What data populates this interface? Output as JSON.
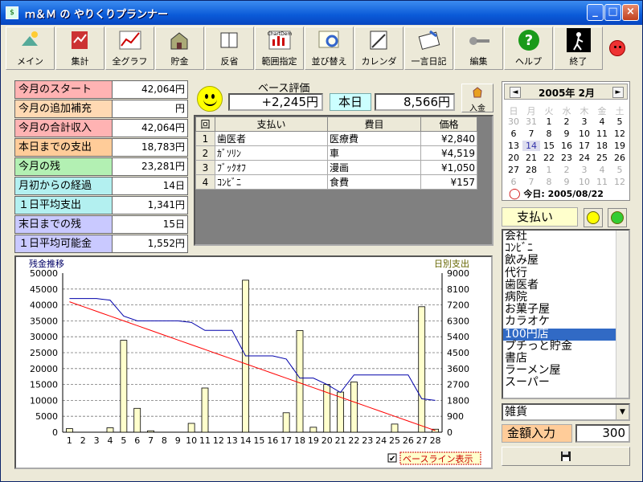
{
  "window": {
    "title": "ｍ＆Ｍ の やりくりプランナー",
    "icon": "app-icon"
  },
  "toolbar": [
    {
      "label": "メイン",
      "icon": "main-icon"
    },
    {
      "label": "集計",
      "icon": "summary-icon"
    },
    {
      "label": "全グラフ",
      "icon": "graph-icon"
    },
    {
      "label": "貯金",
      "icon": "savings-icon"
    },
    {
      "label": "反省",
      "icon": "review-icon"
    },
    {
      "label": "範囲指定",
      "icon": "range-icon"
    },
    {
      "label": "並び替え",
      "icon": "sort-icon"
    },
    {
      "label": "カレンダ",
      "icon": "calendar-icon"
    },
    {
      "label": "一言日記",
      "icon": "diary-icon"
    },
    {
      "label": "編集",
      "icon": "edit-icon"
    },
    {
      "label": "ヘルプ",
      "icon": "help-icon"
    },
    {
      "label": "終了",
      "icon": "exit-icon"
    }
  ],
  "toolbar_extra": {
    "range_icon_text": "ChartDem"
  },
  "summary": [
    {
      "label": "今月のスタート",
      "value": "42,064円",
      "color": "#ffb3b3"
    },
    {
      "label": "今月の追加補充",
      "value": "円",
      "color": "#ffd9b3"
    },
    {
      "label": "今月の合計収入",
      "value": "42,064円",
      "color": "#ffb3b3"
    },
    {
      "label": "本日までの支出",
      "value": "18,783円",
      "color": "#ffcc99"
    },
    {
      "label": "今月の残",
      "value": "23,281円",
      "color": "#b3f0b3"
    },
    {
      "label": "月初からの経過",
      "value": "14日",
      "color": "#b3f0f0"
    },
    {
      "label": "１日平均支出",
      "value": "1,341円",
      "color": "#b3f0f0"
    },
    {
      "label": "末日までの残",
      "value": "15日",
      "color": "#c9c9ff"
    },
    {
      "label": "１日平均可能金",
      "value": "1,552円",
      "color": "#c9c9ff"
    }
  ],
  "evaluation": {
    "label": "ベース評価",
    "value": "+2,245円",
    "today_label": "本日",
    "today_value": "8,566円",
    "deposit_label": "入金"
  },
  "payments": {
    "headers": [
      "回",
      "支払い",
      "費目",
      "価格"
    ],
    "rows": [
      [
        "1",
        "歯医者",
        "医療費",
        "¥2,840"
      ],
      [
        "2",
        "ｶﾞｿﾘﾝ",
        "車",
        "¥4,519"
      ],
      [
        "3",
        "ﾌﾞｯｸｵﾌ",
        "漫画",
        "¥1,050"
      ],
      [
        "4",
        "ｺﾝﾋﾞﾆ",
        "食費",
        "¥157"
      ]
    ]
  },
  "chart_data": {
    "type": "bar+line",
    "left_axis_label": "残金推移",
    "right_axis_label": "日別支出",
    "x": [
      1,
      2,
      3,
      4,
      5,
      6,
      7,
      8,
      9,
      10,
      11,
      12,
      13,
      14,
      15,
      16,
      17,
      18,
      19,
      20,
      21,
      22,
      23,
      24,
      25,
      26,
      27,
      28
    ],
    "ylim_left": [
      0,
      50000
    ],
    "ylim_right": [
      0,
      9000
    ],
    "yticks_left": [
      0,
      5000,
      10000,
      15000,
      20000,
      25000,
      30000,
      35000,
      40000,
      45000,
      50000
    ],
    "yticks_right": [
      0,
      900,
      1800,
      2700,
      3600,
      4500,
      5400,
      6300,
      7200,
      8100,
      9000
    ],
    "series": [
      {
        "name": "日別支出",
        "kind": "bar",
        "axis": "right",
        "color": "#ffffcc",
        "values": [
          200,
          0,
          0,
          250,
          5200,
          1350,
          80,
          0,
          0,
          500,
          2500,
          0,
          0,
          8600,
          0,
          0,
          1100,
          5750,
          280,
          2700,
          2270,
          2840,
          0,
          0,
          460,
          0,
          7100,
          170
        ]
      },
      {
        "kind": "line",
        "axis": "left",
        "color": "#0000aa",
        "values": [
          42000,
          42000,
          42000,
          41500,
          36500,
          35000,
          35000,
          35000,
          35000,
          34500,
          32000,
          32000,
          32000,
          24000,
          24000,
          24000,
          23000,
          17000,
          17000,
          15000,
          12500,
          18000,
          18000,
          18000,
          18000,
          18000,
          10500,
          10000
        ]
      },
      {
        "kind": "line",
        "axis": "left",
        "color": "#ff0000",
        "values": [
          41000,
          39500,
          38000,
          36500,
          35000,
          33500,
          32000,
          30500,
          29000,
          27500,
          26000,
          24500,
          23000,
          21500,
          20000,
          18500,
          17000,
          15500,
          14000,
          12500,
          11000,
          9500,
          8000,
          6500,
          5000,
          3500,
          2000,
          500
        ]
      }
    ],
    "grid": true,
    "checkbox": {
      "label": "ベースライン表示",
      "checked": true
    }
  },
  "calendar": {
    "title": "2005年 2月",
    "weekdays": [
      "日",
      "月",
      "火",
      "水",
      "木",
      "金",
      "土"
    ],
    "weeks": [
      [
        "30",
        "31",
        "1",
        "2",
        "3",
        "4",
        "5"
      ],
      [
        "6",
        "7",
        "8",
        "9",
        "10",
        "11",
        "12"
      ],
      [
        "13",
        "14",
        "15",
        "16",
        "17",
        "18",
        "19"
      ],
      [
        "20",
        "21",
        "22",
        "23",
        "24",
        "25",
        "26"
      ],
      [
        "27",
        "28",
        "1",
        "2",
        "3",
        "4",
        "5"
      ],
      [
        "6",
        "7",
        "8",
        "9",
        "10",
        "11",
        "12"
      ]
    ],
    "today_text": "今日: 2005/08/22",
    "prev": "◄",
    "next": "►"
  },
  "category": {
    "label": "支払い"
  },
  "items": [
    "会社",
    "ｺﾝﾋﾞﾆ",
    "飲み屋",
    "代行",
    "歯医者",
    "病院",
    "お菓子屋",
    "カラオケ",
    "100円店",
    "プチっと貯金",
    "書店",
    "ラーメン屋",
    "スーパー"
  ],
  "selected_item": "100円店",
  "combo": {
    "value": "雑貨"
  },
  "amount": {
    "label": "金額入力",
    "value": "300"
  }
}
